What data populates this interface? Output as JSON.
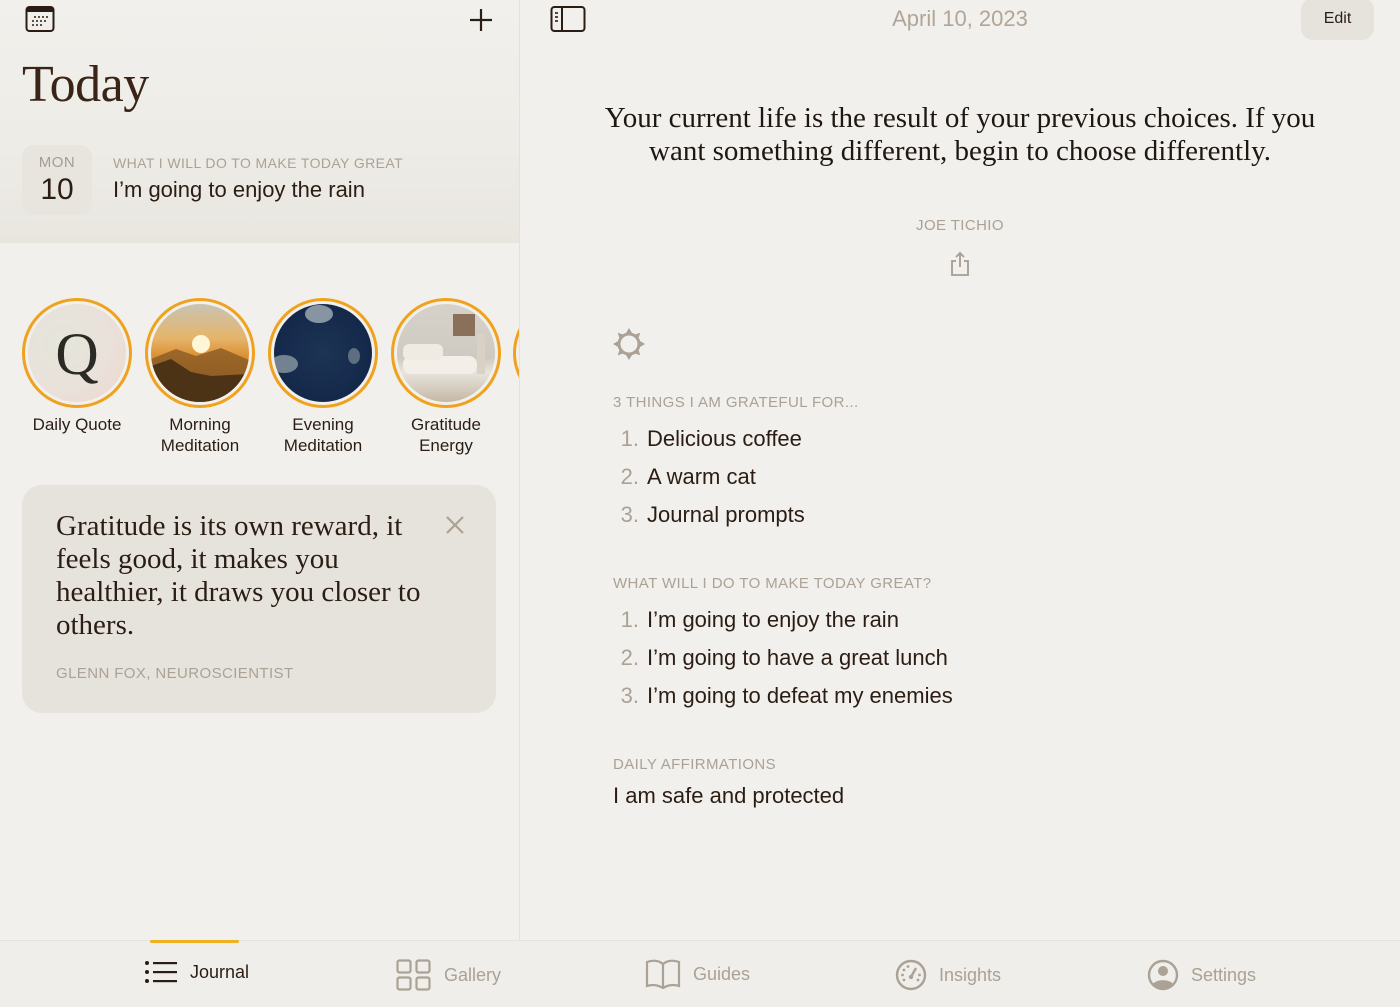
{
  "left": {
    "title": "Today",
    "date_badge": {
      "day_of_week": "MON",
      "day": "10"
    },
    "intention": {
      "label": "WHAT I WILL DO TO MAKE TODAY GREAT",
      "text": "I’m going to enjoy the rain"
    },
    "stories": [
      {
        "label": "Daily Quote",
        "icon": "Q",
        "image": "quote-letter"
      },
      {
        "label": "Morning Meditation",
        "image": "sunrise-mountains"
      },
      {
        "label": "Evening Meditation",
        "image": "crescent-moon-night-sky"
      },
      {
        "label": "Gratitude Energy",
        "image": "living-room-sofa"
      }
    ],
    "quote_card": {
      "text": "Gratitude is its own reward, it feels good, it makes you healthier, it draws you closer to others.",
      "author": "GLENN FOX, NEUROSCIENTIST"
    }
  },
  "right": {
    "date": "April 10, 2023",
    "edit_label": "Edit",
    "quote": {
      "text": "Your current life is the result of your previous choices. If you want something different, begin to choose differently.",
      "author": "JOE TICHIO"
    },
    "sections": [
      {
        "label": "3 THINGS I AM GRATEFUL FOR...",
        "items": [
          "Delicious coffee",
          "A warm cat",
          "Journal prompts"
        ]
      },
      {
        "label": "WHAT WILL I DO TO MAKE TODAY GREAT?",
        "items": [
          "I’m going to enjoy the rain",
          "I’m going to have a great lunch",
          "I’m going to defeat my enemies"
        ]
      },
      {
        "label": "DAILY AFFIRMATIONS",
        "text": "I am safe and protected"
      }
    ]
  },
  "tabbar": {
    "tabs": [
      {
        "label": "Journal",
        "icon": "list-icon",
        "active": true
      },
      {
        "label": "Gallery",
        "icon": "grid-icon",
        "active": false
      },
      {
        "label": "Guides",
        "icon": "book-icon",
        "active": false
      },
      {
        "label": "Insights",
        "icon": "gauge-icon",
        "active": false
      },
      {
        "label": "Settings",
        "icon": "person-circle-icon",
        "active": false
      }
    ]
  },
  "colors": {
    "accent": "#f0a21e",
    "background": "#f1f0ec",
    "text": "#2b1d14",
    "muted": "#aba194",
    "card": "#e6e3dd"
  }
}
